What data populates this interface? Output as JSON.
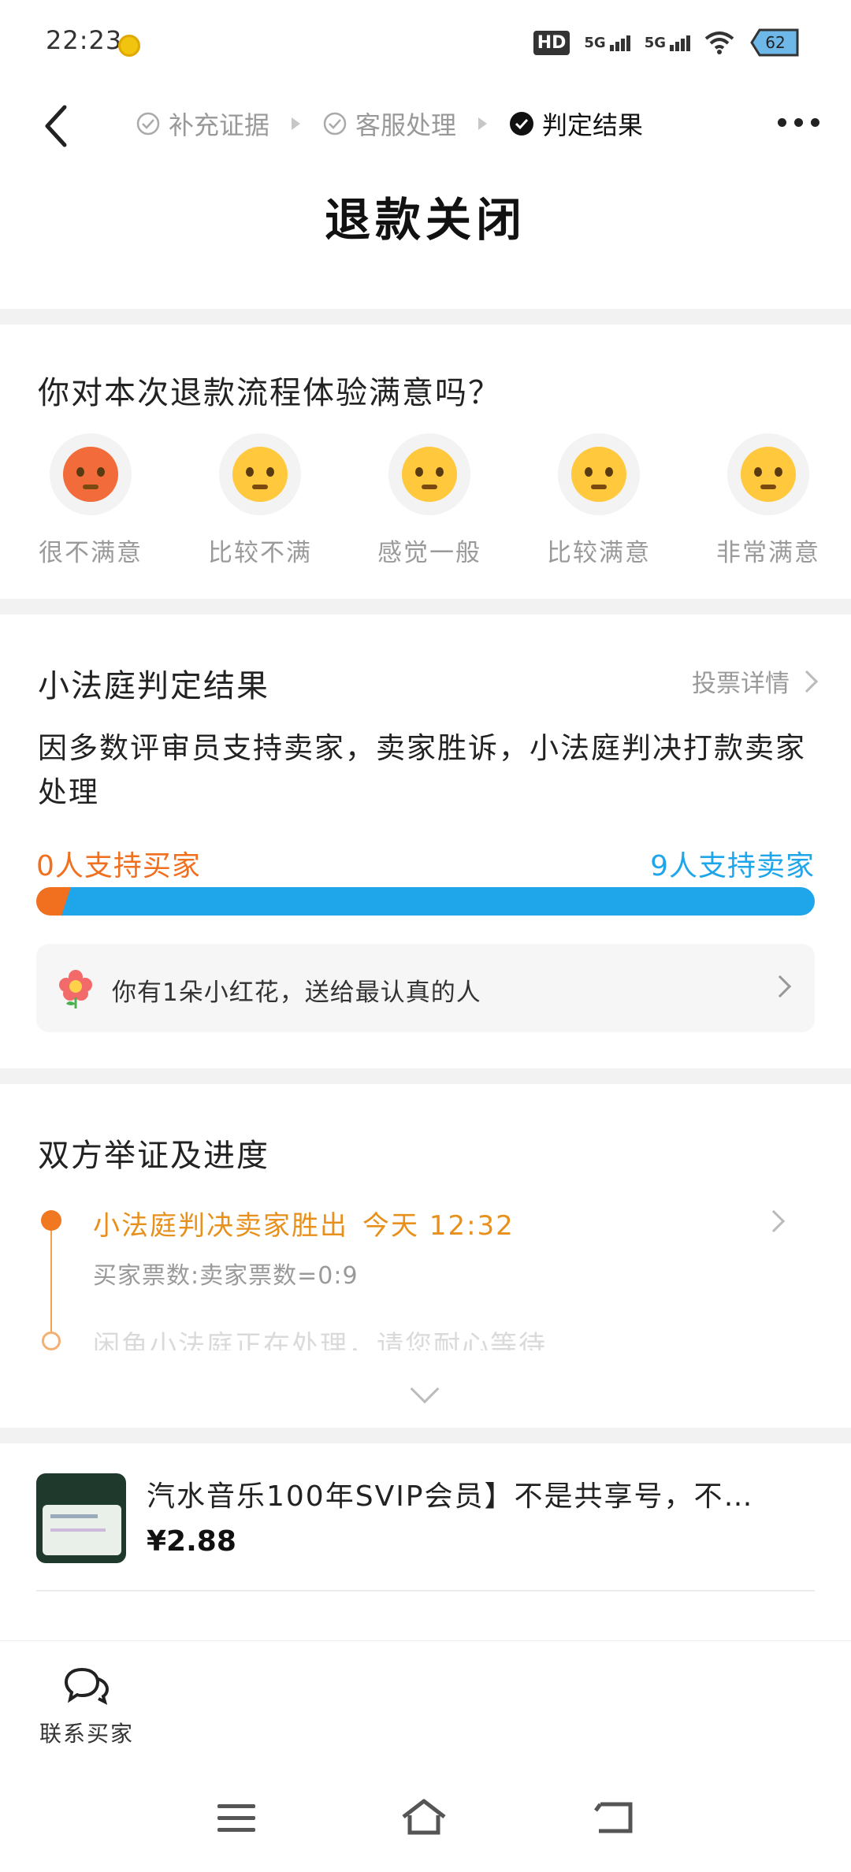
{
  "status_bar": {
    "time": "22:23",
    "hd_label": "HD",
    "signal1_label": "5G",
    "signal2_label": "5G",
    "battery": "62",
    "icons": [
      "notification-coin-icon",
      "hd-voice-icon",
      "signal-icon",
      "wifi-icon",
      "battery-icon"
    ]
  },
  "nav": {
    "steps": [
      {
        "label": "补充证据",
        "state": "done"
      },
      {
        "label": "客服处理",
        "state": "done"
      },
      {
        "label": "判定结果",
        "state": "current"
      }
    ]
  },
  "title": "退款关闭",
  "satisfaction": {
    "question": "你对本次退款流程体验满意吗？",
    "options": [
      {
        "label": "很不满意",
        "icon": "angry-face-icon"
      },
      {
        "label": "比较不满",
        "icon": "unamused-face-icon"
      },
      {
        "label": "感觉一般",
        "icon": "neutral-face-icon"
      },
      {
        "label": "比较满意",
        "icon": "shy-face-icon"
      },
      {
        "label": "非常满意",
        "icon": "kissing-face-icon"
      }
    ]
  },
  "verdict": {
    "title": "小法庭判定结果",
    "link": "投票详情",
    "text": "因多数评审员支持卖家，卖家胜诉，小法庭判决打款卖家处理",
    "buyer_votes_label": "0人支持买家",
    "seller_votes_label": "9人支持卖家",
    "buyer_votes": 0,
    "seller_votes": 9,
    "colors": {
      "buyer": "#f07020",
      "seller": "#1fa6ea"
    },
    "flower_text": "你有1朵小红花，送给最认真的人"
  },
  "progress": {
    "title": "双方举证及进度",
    "events": [
      {
        "title": "小法庭判决卖家胜出",
        "time": "今天 12:32",
        "detail": "买家票数:卖家票数=0:9"
      },
      {
        "title": "闲鱼小法庭正在处理，请您耐心等待",
        "time": "",
        "detail": ""
      }
    ]
  },
  "product": {
    "title": "汽水音乐100年SVIP会员】不是共享号，不…",
    "price": "¥2.88"
  },
  "bottom": {
    "contact_label": "联系买家"
  }
}
